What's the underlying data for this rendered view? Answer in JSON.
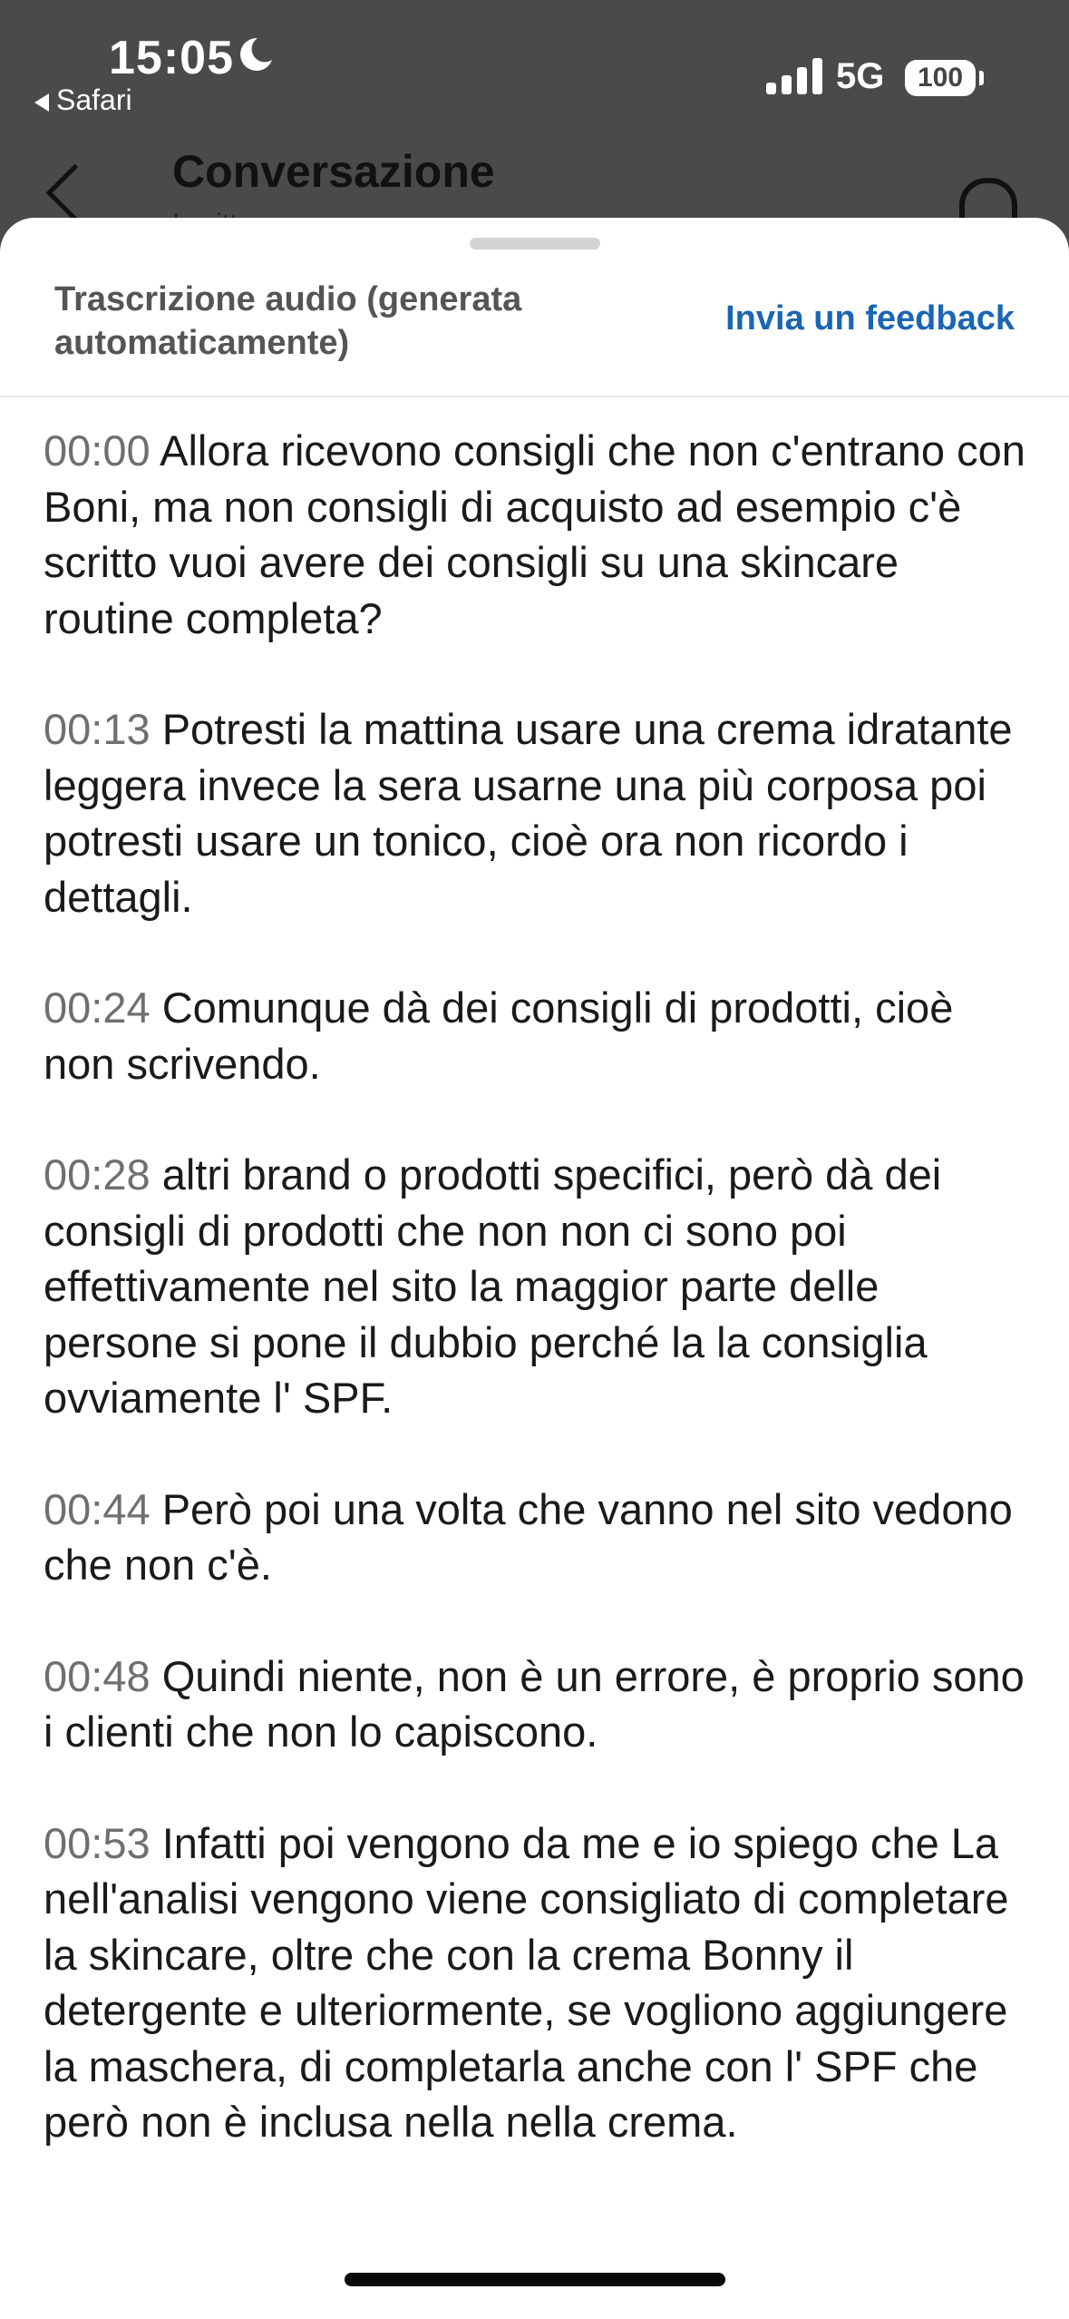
{
  "status_bar": {
    "time": "15:05",
    "back_app": "Safari",
    "network": "5G",
    "battery": "100"
  },
  "background_header": {
    "title": "Conversazione",
    "subtitle": "Iscritto"
  },
  "sheet": {
    "title": "Trascrizione audio (generata automaticamente)",
    "feedback_label": "Invia un feedback",
    "segments": [
      {
        "ts": "00:00",
        "text": "Allora ricevono consigli che non c'entrano con Boni, ma non consigli di acquisto ad esempio c'è scritto vuoi avere dei consigli su una skincare routine completa?"
      },
      {
        "ts": "00:13",
        "text": "Potresti la mattina usare una crema idratante leggera invece la sera usarne una più corposa poi potresti usare un tonico, cioè ora non ricordo i dettagli."
      },
      {
        "ts": "00:24",
        "text": "Comunque dà dei consigli di prodotti, cioè non scrivendo."
      },
      {
        "ts": "00:28",
        "text": "altri brand o prodotti specifici, però dà dei consigli di prodotti che non non ci sono poi effettivamente nel sito la maggior parte delle persone si pone il dubbio perché la la consiglia ovviamente l' SPF."
      },
      {
        "ts": "00:44",
        "text": "Però poi una volta che vanno nel sito vedono che non c'è."
      },
      {
        "ts": "00:48",
        "text": "Quindi niente, non è un errore, è proprio sono i clienti che non lo capiscono."
      },
      {
        "ts": "00:53",
        "text": "Infatti poi vengono da me e io spiego che La  nell'analisi vengono viene consigliato di completare la skincare, oltre che con la crema Bonny il detergente e  ulteriormente, se vogliono aggiungere la maschera,  di completarla anche con l' SPF che però non è inclusa nella nella crema."
      }
    ]
  }
}
